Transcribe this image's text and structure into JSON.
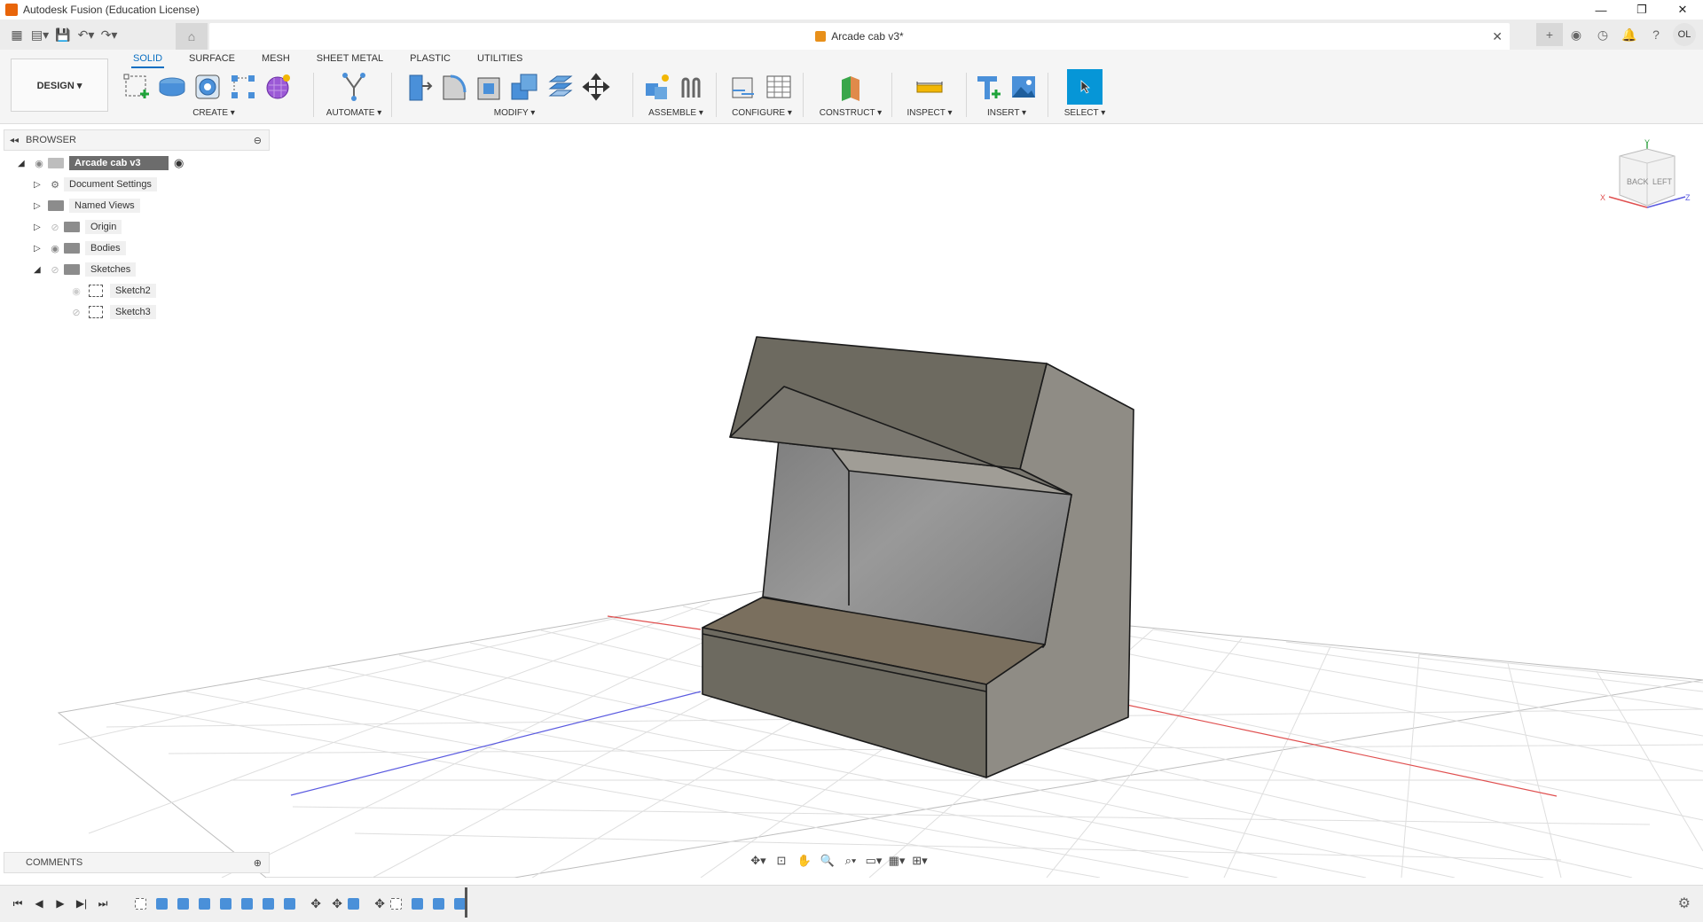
{
  "window": {
    "title": "Autodesk Fusion (Education License)",
    "minimize": "—",
    "restore": "❐",
    "close": "✕"
  },
  "document_tab": {
    "title": "Arcade cab v3*",
    "close": "✕"
  },
  "user": {
    "initials": "OL"
  },
  "ribbon": {
    "tabs": [
      "SOLID",
      "SURFACE",
      "MESH",
      "SHEET METAL",
      "PLASTIC",
      "UTILITIES"
    ],
    "active_tab": "SOLID",
    "workspace": "DESIGN ▾",
    "groups": {
      "create": "CREATE ▾",
      "automate": "AUTOMATE ▾",
      "modify": "MODIFY ▾",
      "assemble": "ASSEMBLE ▾",
      "configure": "CONFIGURE ▾",
      "construct": "CONSTRUCT ▾",
      "inspect": "INSPECT ▾",
      "insert": "INSERT ▾",
      "select": "SELECT ▾"
    }
  },
  "browser": {
    "title": "BROWSER",
    "root": "Arcade cab v3",
    "items": [
      "Document Settings",
      "Named Views",
      "Origin",
      "Bodies",
      "Sketches"
    ],
    "sketches": [
      "Sketch2",
      "Sketch3"
    ]
  },
  "comments": {
    "title": "COMMENTS"
  },
  "viewcube": {
    "back": "BACK",
    "left": "LEFT",
    "x": "X",
    "y": "Y",
    "z": "Z"
  },
  "colors": {
    "accent": "#0a6fc2",
    "select_button": "#0696d7",
    "body_dark": "#6d6a60",
    "body_light": "#8f8c85",
    "body_top": "#7a6f5e",
    "x_axis": "#e05050",
    "y_axis": "#5a5ae0",
    "grid": "#cfcfcf"
  }
}
